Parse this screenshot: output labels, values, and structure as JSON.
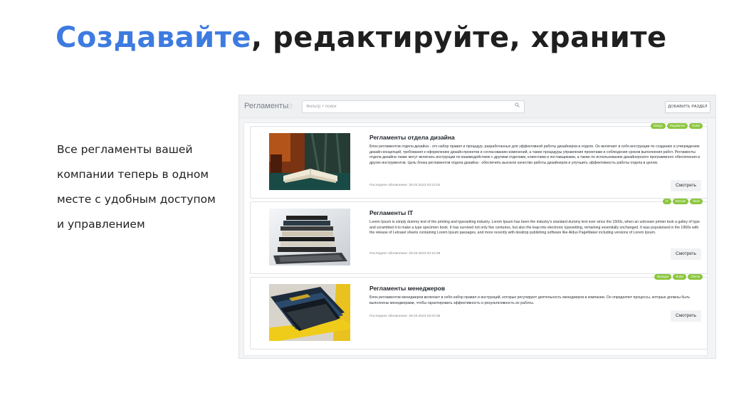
{
  "slide": {
    "title_accent": "Создавайте",
    "title_rest": ", редактируйте, храните",
    "text_lines": [
      "Все регламенты вашей",
      "компании теперь в одном",
      "месте с удобным доступом",
      "и управлением"
    ]
  },
  "app": {
    "title": "Регламенты",
    "star_icon": "star-icon",
    "search": {
      "placeholder": "Фильтр + поиск",
      "icon": "search-icon"
    },
    "add_button_label": "ДОБАВИТЬ РАЗДЕЛ",
    "view_label": "Смотреть",
    "cards": [
      {
        "title": "Регламенты отдела дизайна",
        "description": "Блок регламентов отдела дизайна - это набор правил и процедур, разработанных для эффективной работы дизайнеров в отделе. Он включает в себя инструкции по созданию и утверждению дизайн-концепций, требования к оформлению дизайн-проектов и согласованию изменений, а также процедуры управления проектами и соблюдения сроков выполнения работ. Регламенты отдела дизайна также могут включать инструкции по взаимодействию с другими отделами, клиентами и поставщиками, а также по использованию дизайнерского программного обеспечения и других инструментов. Цель блока регламентов отдела дизайна - обеспечить высокое качество работы дизайнеров и улучшить эффективность работы отдела в целом.",
        "updated": "Последнее обновление: 28.03.2023 03:22:02",
        "tags": [
          "Design",
          "Regulamen",
          "Rules"
        ],
        "image": "book-on-desk-image"
      },
      {
        "title": "Регламенты IT",
        "description": "Lorem Ipsum is simply dummy text of the printing and typesetting industry. Lorem Ipsum has been the industry's standard dummy text ever since the 1500s, when an unknown printer took a galley of type and scrambled it to make a type specimen book. It has survived not only five centuries, but also the leap into electronic typesetting, remaining essentially unchanged. It was popularised in the 1960s with the release of Letraset sheets containing Lorem Ipsum passages, and more recently with desktop publishing software like Aldus PageMaker including versions of Lorem Ipsum.",
        "updated": "Последнее обновление: 28.03.2023 03:15:38",
        "tags": [
          "IT",
          "Remote",
          "Work"
        ],
        "image": "book-stack-laptop-image"
      },
      {
        "title": "Регламенты менеджеров",
        "description": "Блок регламентов менеджеров включает в себя набор правил и инструкций, которые регулируют деятельность менеджеров в компании. Он определяет процессы, которые должны быть выполнены менеджерами, чтобы гарантировать эффективность и результативность их работы.",
        "updated": "Последнее обновление: 28.03.2023 03:20:35",
        "tags": [
          "Manager",
          "Rules",
          "Clients"
        ],
        "image": "folders-box-image"
      }
    ]
  }
}
